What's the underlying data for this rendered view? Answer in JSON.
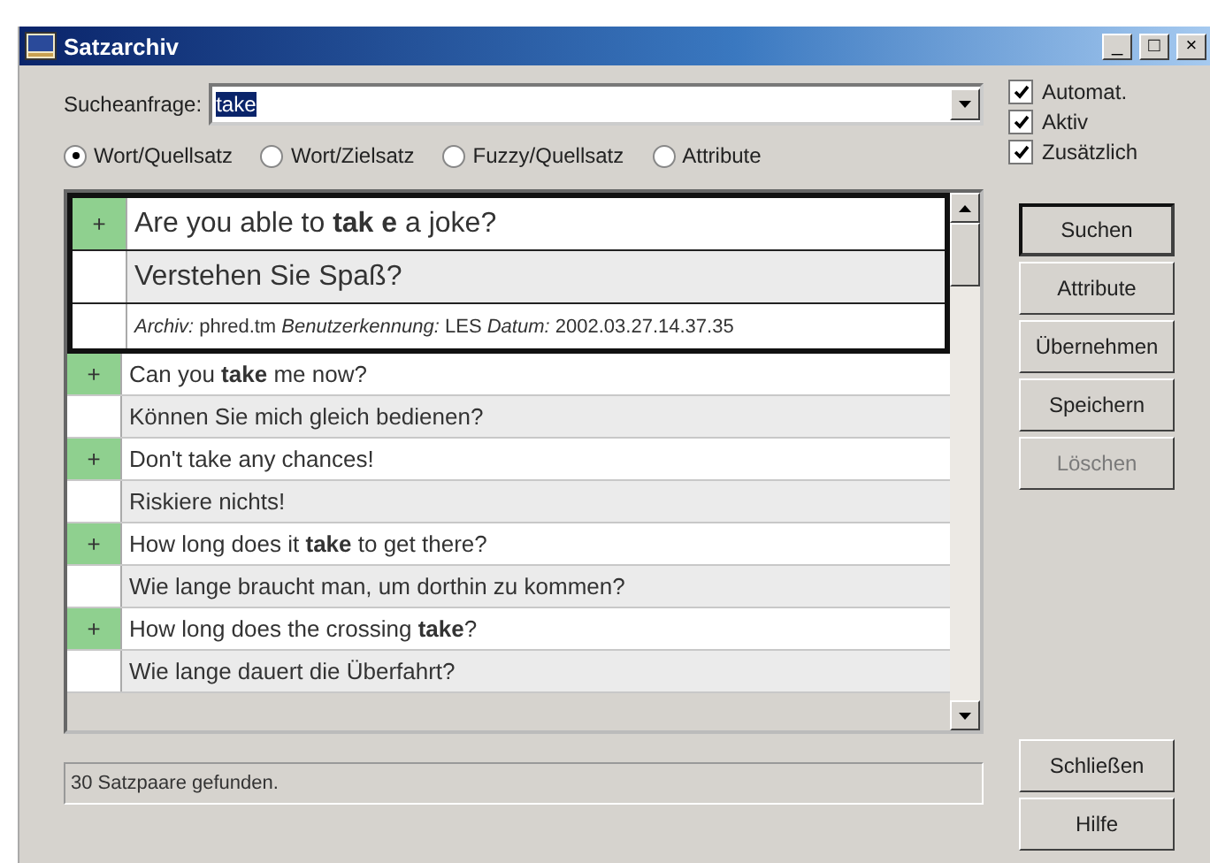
{
  "window": {
    "title": "Satzarchiv",
    "controls": [
      "_",
      "□",
      "×"
    ]
  },
  "search": {
    "label": "Sucheanfrage:",
    "value": "take"
  },
  "modes": [
    {
      "label": "Wort/Quellsatz",
      "selected": true
    },
    {
      "label": "Wort/Zielsatz",
      "selected": false
    },
    {
      "label": "Fuzzy/Quellsatz",
      "selected": false
    },
    {
      "label": "Attribute",
      "selected": false
    }
  ],
  "options": [
    {
      "label": "Automat.",
      "checked": true
    },
    {
      "label": "Aktiv",
      "checked": true
    },
    {
      "label": "Zusätzlich",
      "checked": true
    }
  ],
  "pairs": [
    {
      "marker": "+",
      "source": "Are you able to **tak e** a joke?",
      "target": "Verstehen Sie Spaß?",
      "meta": "*Archiv:* phred.tm *Benutzerkennung:* LES *Datum:* 2002.03.27.14.37.35",
      "selected": true
    },
    {
      "marker": "+",
      "source": "Can you **take** me now?",
      "target": "Können Sie mich gleich bedienen?",
      "selected": false
    },
    {
      "marker": "+",
      "source": "Don't take any chances!",
      "target": "Riskiere nichts!",
      "selected": false
    },
    {
      "marker": "+",
      "source": "How long does it **take** to get there?",
      "target": "Wie lange braucht man, um dorthin zu kommen?",
      "selected": false
    },
    {
      "marker": "+",
      "source": "How long does the crossing **take**?",
      "target": "Wie lange dauert die Überfahrt?",
      "selected": false
    }
  ],
  "buttons": [
    {
      "label": "Suchen",
      "disabled": false,
      "default": true
    },
    {
      "label": "Attribute",
      "disabled": false,
      "default": false
    },
    {
      "label": "Übernehmen",
      "disabled": false,
      "default": false
    },
    {
      "label": "Speichern",
      "disabled": false,
      "default": false
    },
    {
      "label": "Löschen",
      "disabled": true,
      "default": false
    }
  ],
  "bottom_buttons": [
    {
      "label": "Schließen",
      "disabled": false,
      "default": false
    },
    {
      "label": "Hilfe",
      "disabled": false,
      "default": false
    }
  ],
  "status": "30 Satzpaare gefunden."
}
